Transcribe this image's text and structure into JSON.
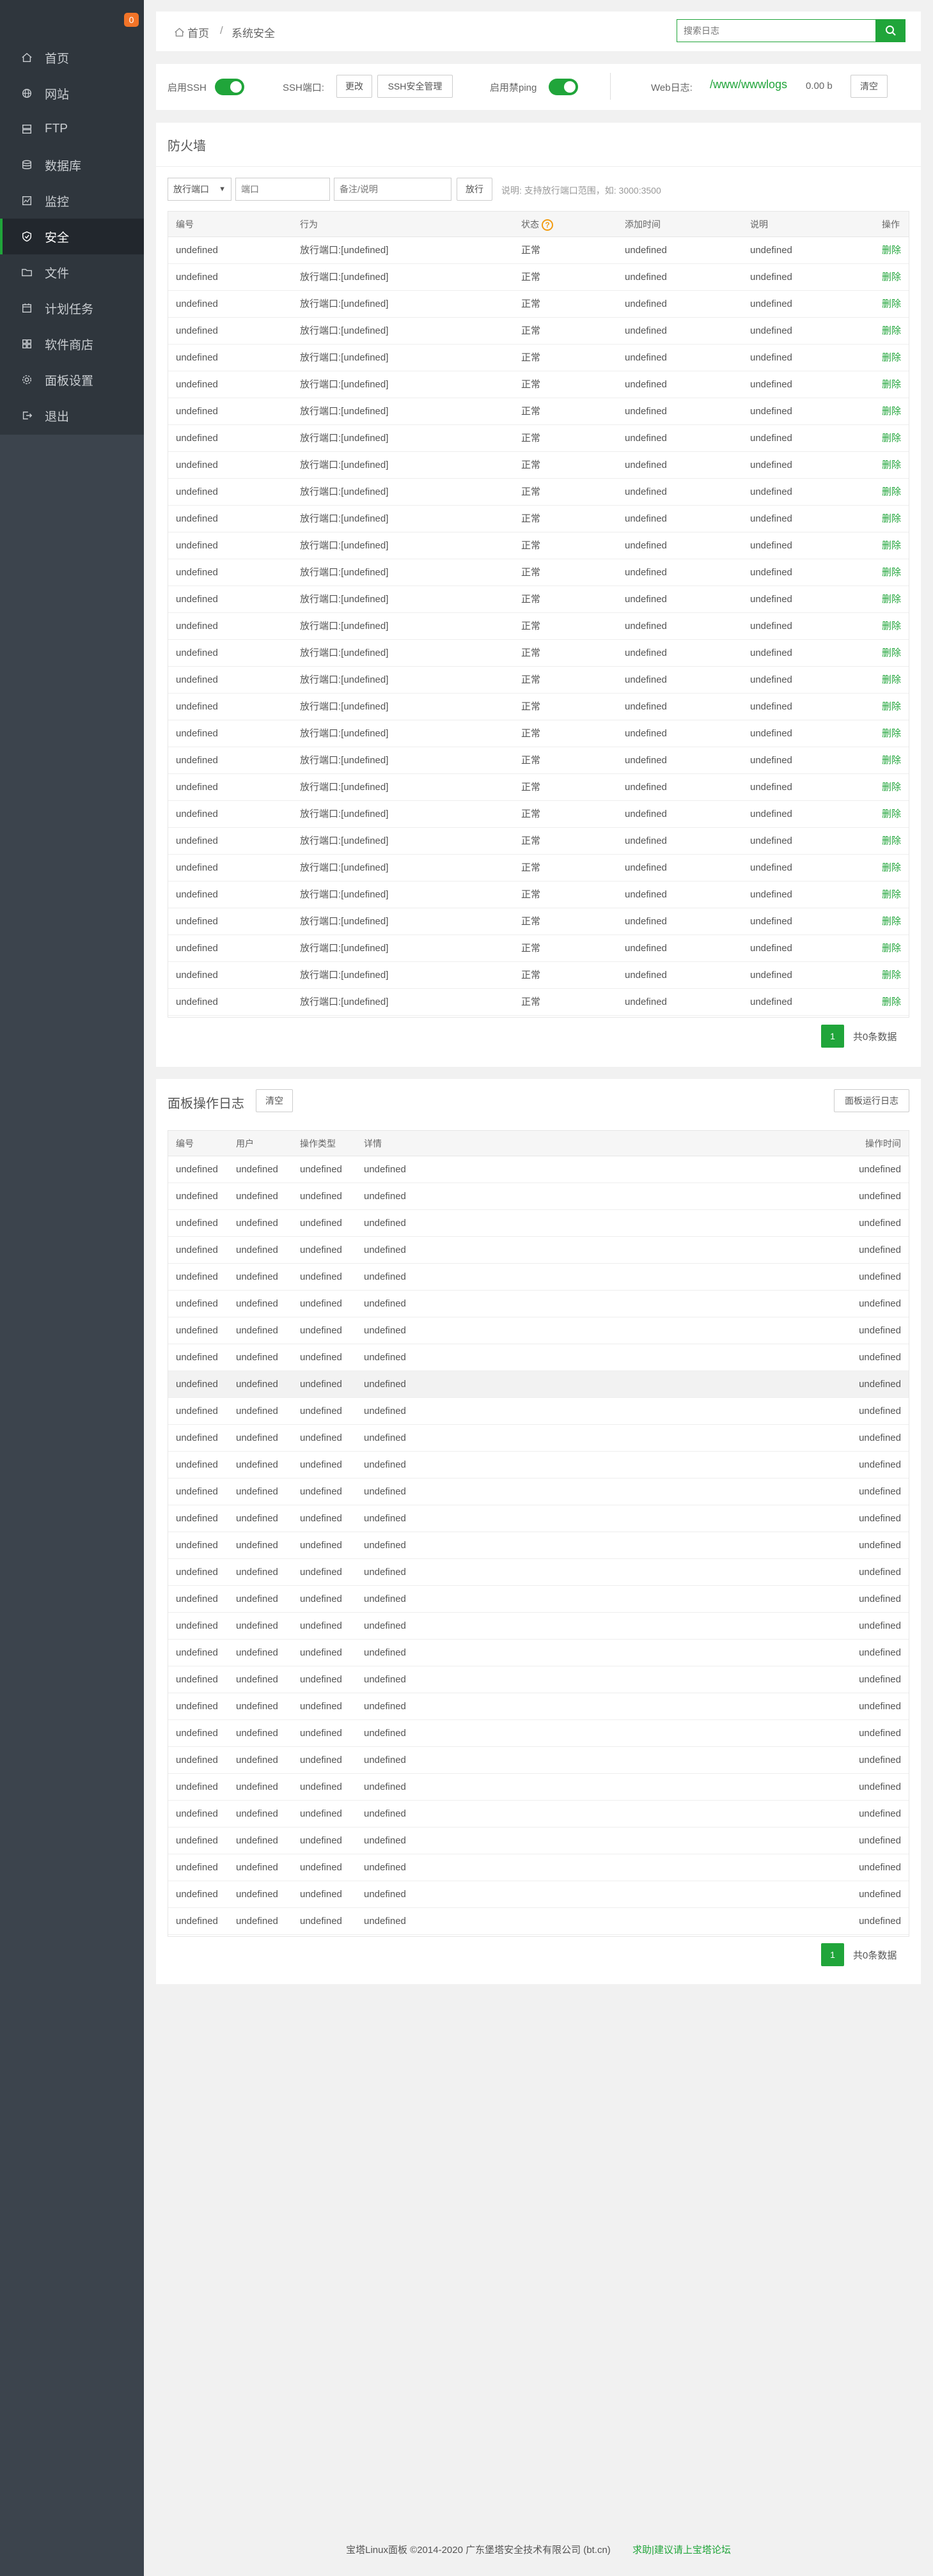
{
  "sidebar": {
    "badge": "0",
    "items": [
      {
        "label": "首页",
        "icon": "home-icon",
        "active": false
      },
      {
        "label": "网站",
        "icon": "globe-icon",
        "active": false
      },
      {
        "label": "FTP",
        "icon": "server-icon",
        "active": false
      },
      {
        "label": "数据库",
        "icon": "database-icon",
        "active": false
      },
      {
        "label": "监控",
        "icon": "monitor-icon",
        "active": false
      },
      {
        "label": "安全",
        "icon": "shield-icon",
        "active": true
      },
      {
        "label": "文件",
        "icon": "folder-icon",
        "active": false
      },
      {
        "label": "计划任务",
        "icon": "calendar-icon",
        "active": false
      },
      {
        "label": "软件商店",
        "icon": "grid-icon",
        "active": false
      },
      {
        "label": "面板设置",
        "icon": "gear-icon",
        "active": false
      },
      {
        "label": "退出",
        "icon": "logout-icon",
        "active": false
      }
    ]
  },
  "breadcrumb": {
    "home": "首页",
    "separator": "/",
    "current": "系统安全"
  },
  "search": {
    "placeholder": "搜索日志"
  },
  "toolbar": {
    "ssh_label": "启用SSH",
    "ssh_enabled": true,
    "ssh_port_label": "SSH端口:",
    "change_label": "更改",
    "ssh_security_label": "SSH安全管理",
    "ping_label": "启用禁ping",
    "ping_enabled": true,
    "weblog_label": "Web日志:",
    "weblog_path": "/www/wwwlogs",
    "weblog_size": "0.00 b",
    "clear_label": "清空"
  },
  "firewall": {
    "title": "防火墙",
    "type_select": "放行端口",
    "port_placeholder": "端口",
    "note_placeholder": "备注/说明",
    "submit_label": "放行",
    "hint": "说明: 支持放行端口范围，如: 3000:3500",
    "columns": [
      "编号",
      "行为",
      "状态",
      "添加时间",
      "说明",
      "操作"
    ],
    "rows": [
      [
        "undefined",
        "放行端口:[undefined]",
        "正常",
        "undefined",
        "undefined",
        "删除"
      ],
      [
        "undefined",
        "放行端口:[undefined]",
        "正常",
        "undefined",
        "undefined",
        "删除"
      ],
      [
        "undefined",
        "放行端口:[undefined]",
        "正常",
        "undefined",
        "undefined",
        "删除"
      ],
      [
        "undefined",
        "放行端口:[undefined]",
        "正常",
        "undefined",
        "undefined",
        "删除"
      ],
      [
        "undefined",
        "放行端口:[undefined]",
        "正常",
        "undefined",
        "undefined",
        "删除"
      ],
      [
        "undefined",
        "放行端口:[undefined]",
        "正常",
        "undefined",
        "undefined",
        "删除"
      ],
      [
        "undefined",
        "放行端口:[undefined]",
        "正常",
        "undefined",
        "undefined",
        "删除"
      ],
      [
        "undefined",
        "放行端口:[undefined]",
        "正常",
        "undefined",
        "undefined",
        "删除"
      ],
      [
        "undefined",
        "放行端口:[undefined]",
        "正常",
        "undefined",
        "undefined",
        "删除"
      ],
      [
        "undefined",
        "放行端口:[undefined]",
        "正常",
        "undefined",
        "undefined",
        "删除"
      ],
      [
        "undefined",
        "放行端口:[undefined]",
        "正常",
        "undefined",
        "undefined",
        "删除"
      ],
      [
        "undefined",
        "放行端口:[undefined]",
        "正常",
        "undefined",
        "undefined",
        "删除"
      ],
      [
        "undefined",
        "放行端口:[undefined]",
        "正常",
        "undefined",
        "undefined",
        "删除"
      ],
      [
        "undefined",
        "放行端口:[undefined]",
        "正常",
        "undefined",
        "undefined",
        "删除"
      ],
      [
        "undefined",
        "放行端口:[undefined]",
        "正常",
        "undefined",
        "undefined",
        "删除"
      ],
      [
        "undefined",
        "放行端口:[undefined]",
        "正常",
        "undefined",
        "undefined",
        "删除"
      ],
      [
        "undefined",
        "放行端口:[undefined]",
        "正常",
        "undefined",
        "undefined",
        "删除"
      ],
      [
        "undefined",
        "放行端口:[undefined]",
        "正常",
        "undefined",
        "undefined",
        "删除"
      ],
      [
        "undefined",
        "放行端口:[undefined]",
        "正常",
        "undefined",
        "undefined",
        "删除"
      ],
      [
        "undefined",
        "放行端口:[undefined]",
        "正常",
        "undefined",
        "undefined",
        "删除"
      ],
      [
        "undefined",
        "放行端口:[undefined]",
        "正常",
        "undefined",
        "undefined",
        "删除"
      ],
      [
        "undefined",
        "放行端口:[undefined]",
        "正常",
        "undefined",
        "undefined",
        "删除"
      ],
      [
        "undefined",
        "放行端口:[undefined]",
        "正常",
        "undefined",
        "undefined",
        "删除"
      ],
      [
        "undefined",
        "放行端口:[undefined]",
        "正常",
        "undefined",
        "undefined",
        "删除"
      ],
      [
        "undefined",
        "放行端口:[undefined]",
        "正常",
        "undefined",
        "undefined",
        "删除"
      ],
      [
        "undefined",
        "放行端口:[undefined]",
        "正常",
        "undefined",
        "undefined",
        "删除"
      ],
      [
        "undefined",
        "放行端口:[undefined]",
        "正常",
        "undefined",
        "undefined",
        "删除"
      ],
      [
        "undefined",
        "放行端口:[undefined]",
        "正常",
        "undefined",
        "undefined",
        "删除"
      ],
      [
        "undefined",
        "放行端口:[undefined]",
        "正常",
        "undefined",
        "undefined",
        "删除"
      ]
    ],
    "pager": {
      "page": "1",
      "total_text": "共0条数据"
    }
  },
  "oplog": {
    "title": "面板操作日志",
    "clear_label": "清空",
    "run_log_label": "面板运行日志",
    "columns": [
      "编号",
      "用户",
      "操作类型",
      "详情",
      "操作时间"
    ],
    "rows": [
      [
        "undefined",
        "undefined",
        "undefined",
        "undefined",
        "undefined"
      ],
      [
        "undefined",
        "undefined",
        "undefined",
        "undefined",
        "undefined"
      ],
      [
        "undefined",
        "undefined",
        "undefined",
        "undefined",
        "undefined"
      ],
      [
        "undefined",
        "undefined",
        "undefined",
        "undefined",
        "undefined"
      ],
      [
        "undefined",
        "undefined",
        "undefined",
        "undefined",
        "undefined"
      ],
      [
        "undefined",
        "undefined",
        "undefined",
        "undefined",
        "undefined"
      ],
      [
        "undefined",
        "undefined",
        "undefined",
        "undefined",
        "undefined"
      ],
      [
        "undefined",
        "undefined",
        "undefined",
        "undefined",
        "undefined"
      ],
      [
        "undefined",
        "undefined",
        "undefined",
        "undefined",
        "undefined"
      ],
      [
        "undefined",
        "undefined",
        "undefined",
        "undefined",
        "undefined"
      ],
      [
        "undefined",
        "undefined",
        "undefined",
        "undefined",
        "undefined"
      ],
      [
        "undefined",
        "undefined",
        "undefined",
        "undefined",
        "undefined"
      ],
      [
        "undefined",
        "undefined",
        "undefined",
        "undefined",
        "undefined"
      ],
      [
        "undefined",
        "undefined",
        "undefined",
        "undefined",
        "undefined"
      ],
      [
        "undefined",
        "undefined",
        "undefined",
        "undefined",
        "undefined"
      ],
      [
        "undefined",
        "undefined",
        "undefined",
        "undefined",
        "undefined"
      ],
      [
        "undefined",
        "undefined",
        "undefined",
        "undefined",
        "undefined"
      ],
      [
        "undefined",
        "undefined",
        "undefined",
        "undefined",
        "undefined"
      ],
      [
        "undefined",
        "undefined",
        "undefined",
        "undefined",
        "undefined"
      ],
      [
        "undefined",
        "undefined",
        "undefined",
        "undefined",
        "undefined"
      ],
      [
        "undefined",
        "undefined",
        "undefined",
        "undefined",
        "undefined"
      ],
      [
        "undefined",
        "undefined",
        "undefined",
        "undefined",
        "undefined"
      ],
      [
        "undefined",
        "undefined",
        "undefined",
        "undefined",
        "undefined"
      ],
      [
        "undefined",
        "undefined",
        "undefined",
        "undefined",
        "undefined"
      ],
      [
        "undefined",
        "undefined",
        "undefined",
        "undefined",
        "undefined"
      ],
      [
        "undefined",
        "undefined",
        "undefined",
        "undefined",
        "undefined"
      ],
      [
        "undefined",
        "undefined",
        "undefined",
        "undefined",
        "undefined"
      ],
      [
        "undefined",
        "undefined",
        "undefined",
        "undefined",
        "undefined"
      ],
      [
        "undefined",
        "undefined",
        "undefined",
        "undefined",
        "undefined"
      ]
    ],
    "highlighted_row": 8,
    "pager": {
      "page": "1",
      "total_text": "共0条数据"
    }
  },
  "footer": {
    "copyright": "宝塔Linux面板 ©2014-2020 广东堡塔安全技术有限公司 (bt.cn)",
    "link": "求助|建议请上宝塔论坛"
  },
  "colors": {
    "accent": "#20a53a",
    "sidebar": "#3c444d",
    "sidebar_menu": "#2f363d",
    "badge": "#f27428"
  }
}
